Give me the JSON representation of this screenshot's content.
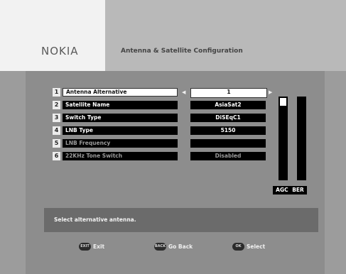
{
  "header": {
    "logo": "NOKIA",
    "title": "Antenna & Satellite Configuration"
  },
  "menu": [
    {
      "num": "1",
      "label": "Antenna Alternative",
      "value": "1",
      "selected": true
    },
    {
      "num": "2",
      "label": "Satellite Name",
      "value": "AsiaSat2"
    },
    {
      "num": "3",
      "label": "Switch Type",
      "value": "DiSEqC1"
    },
    {
      "num": "4",
      "label": "LNB Type",
      "value": "5150"
    },
    {
      "num": "5",
      "label": "LNB Frequency",
      "value": "",
      "dimmed": true
    },
    {
      "num": "6",
      "label": "22KHz Tone Switch",
      "value": "Disabled",
      "dimmed": true
    }
  ],
  "meters": {
    "labels": "AGC BER",
    "agc_level": 0.1,
    "ber_level": 0.0
  },
  "help": {
    "text": "Select alternative antenna."
  },
  "footer": [
    {
      "key": "EXIT",
      "label": "Exit"
    },
    {
      "key": "BACK",
      "label": "Go Back"
    },
    {
      "key": "OK",
      "label": "Select"
    }
  ],
  "arrows": {
    "left": "◀",
    "right": "▶"
  },
  "colors": {
    "background": "#9c9c9c",
    "selected": "#ffffff",
    "normal": "#000000"
  }
}
